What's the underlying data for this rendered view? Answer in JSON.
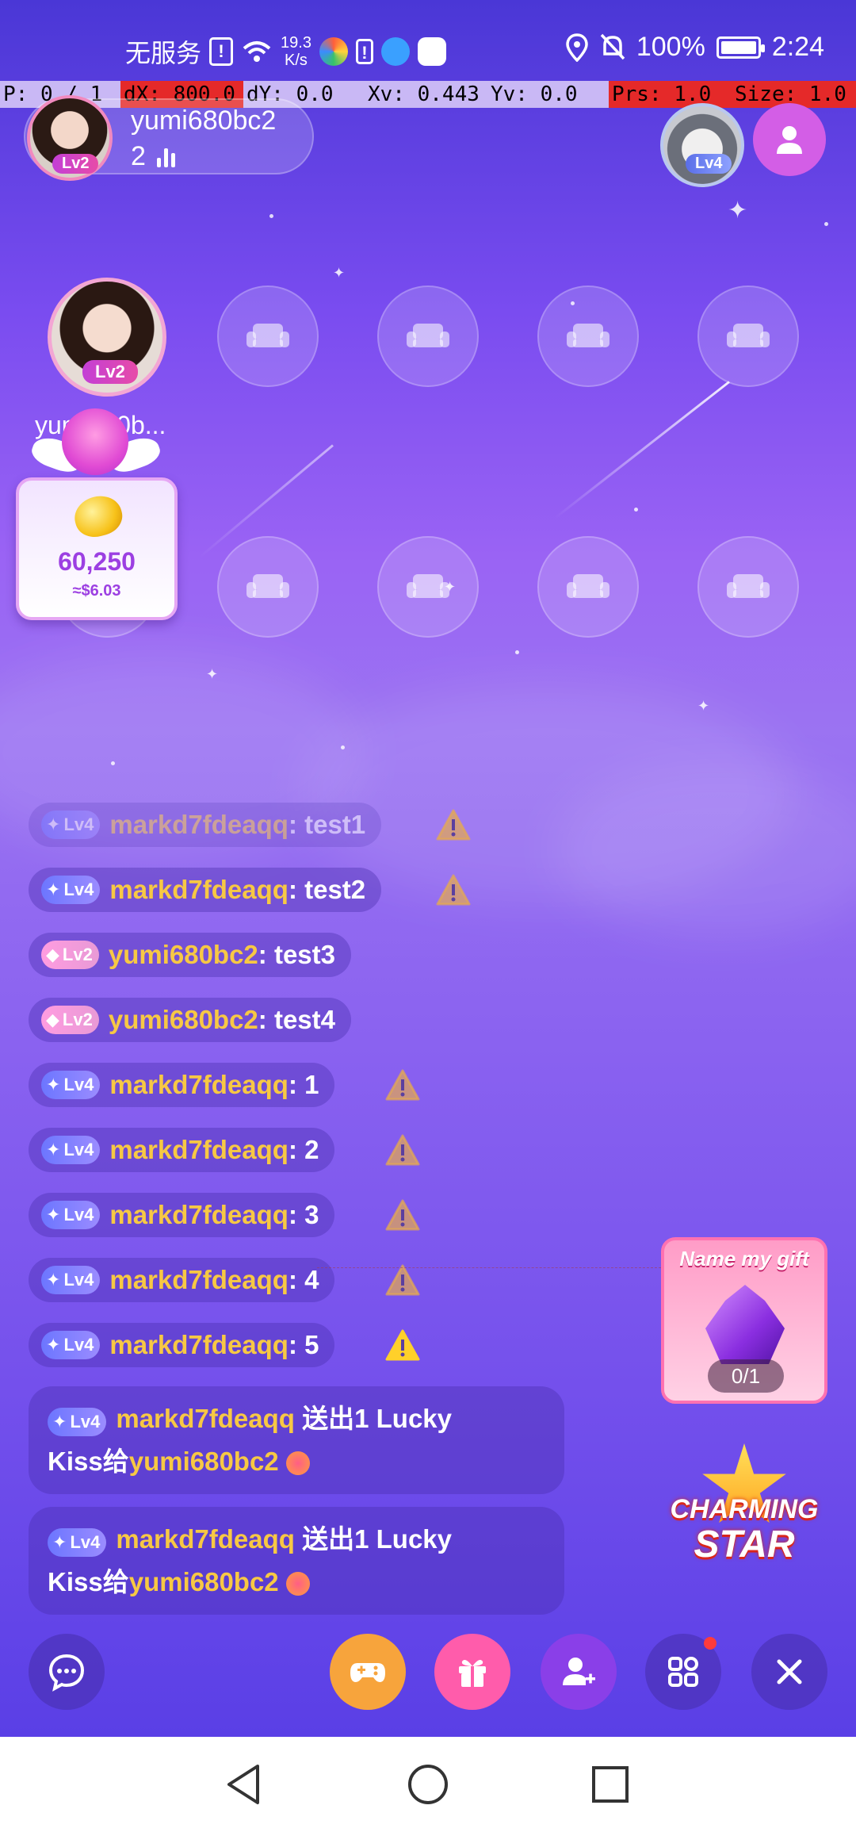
{
  "status_bar": {
    "carrier": "无服务",
    "net_speed_value": "19.3",
    "net_speed_unit": "K/s",
    "battery": "100%",
    "time": "2:24",
    "icons": [
      "sim-alert-icon",
      "wifi-icon",
      "browser-icon",
      "notification-icon",
      "app-icon",
      "huawei-icon",
      "location-icon",
      "mute-bell-icon",
      "battery-icon"
    ]
  },
  "debug_overlay": {
    "pointer": "P: 0 / 1",
    "dx": "dX: 800.0",
    "dy": "dY: 0.0",
    "xv": "Xv: 0.443",
    "yv": "Yv: 0.0",
    "prs": "Prs: 1.0",
    "size": "Size: 1.0"
  },
  "header": {
    "host_name": "yumi680bc2",
    "host_level": "Lv2",
    "viewer_count": "2",
    "right_user_level": "Lv4"
  },
  "seats": {
    "main_seat_level": "Lv2",
    "main_seat_name": "yumi680b...",
    "empty_seat_icon": "sofa-icon"
  },
  "coin_card": {
    "value": "60,250",
    "usd": "≈$6.03"
  },
  "chat": [
    {
      "level": "Lv4",
      "user": "markd7fdeaqq",
      "text": " : test1",
      "warn": true
    },
    {
      "level": "Lv4",
      "user": "markd7fdeaqq",
      "text": " : test2",
      "warn": true
    },
    {
      "level": "Lv2",
      "user": "yumi680bc2",
      "text": " : test3",
      "warn": false
    },
    {
      "level": "Lv2",
      "user": "yumi680bc2",
      "text": " : test4",
      "warn": false
    },
    {
      "level": "Lv4",
      "user": "markd7fdeaqq",
      "text": " : 1",
      "warn": true
    },
    {
      "level": "Lv4",
      "user": "markd7fdeaqq",
      "text": " : 2",
      "warn": true
    },
    {
      "level": "Lv4",
      "user": "markd7fdeaqq",
      "text": " : 3",
      "warn": true
    },
    {
      "level": "Lv4",
      "user": "markd7fdeaqq",
      "text": " : 4",
      "warn": true
    },
    {
      "level": "Lv4",
      "user": "markd7fdeaqq",
      "text": " : 5",
      "warn": true
    }
  ],
  "gift_messages": [
    {
      "level": "Lv4",
      "sender": "markd7fdeaqq",
      "action": " 送出1 Lucky",
      "line2_prefix": "Kiss给",
      "receiver": "yumi680bc2"
    },
    {
      "level": "Lv4",
      "sender": "markd7fdeaqq",
      "action": " 送出1 Lucky",
      "line2_prefix": "Kiss给",
      "receiver": "yumi680bc2"
    }
  ],
  "gift_card": {
    "title": "Name my gift",
    "progress": "0/1"
  },
  "charming_star": {
    "line1": "CHARMING",
    "line2": "STAR"
  },
  "toolbar": {
    "buttons": [
      "chat-icon",
      "game-controller-icon",
      "gift-icon",
      "add-user-icon",
      "apps-grid-icon",
      "close-icon"
    ]
  },
  "colors": {
    "username": "#f7c844",
    "accent": "#9c3fe2",
    "game_button": "#f7a43c",
    "gift_button": "#ff5cab",
    "add_user_button": "#8a3fe8"
  }
}
